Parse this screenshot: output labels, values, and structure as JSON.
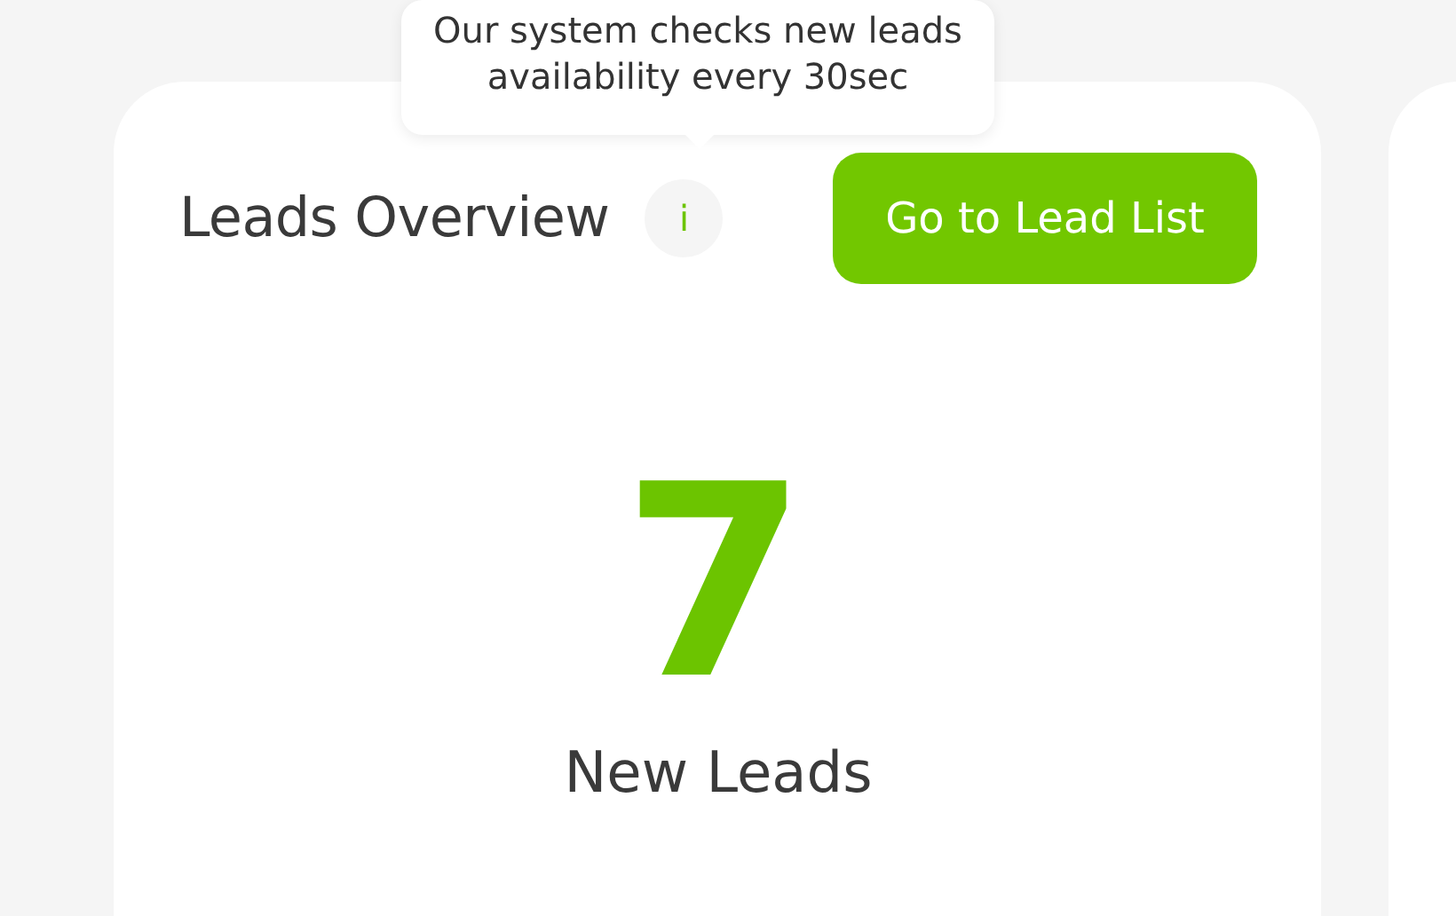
{
  "card": {
    "title": "Leads Overview",
    "info_icon": "i",
    "tooltip": "Our system checks new leads availability every 30sec",
    "button": "Go to Lead List",
    "count": "7",
    "count_label": "New Leads"
  }
}
